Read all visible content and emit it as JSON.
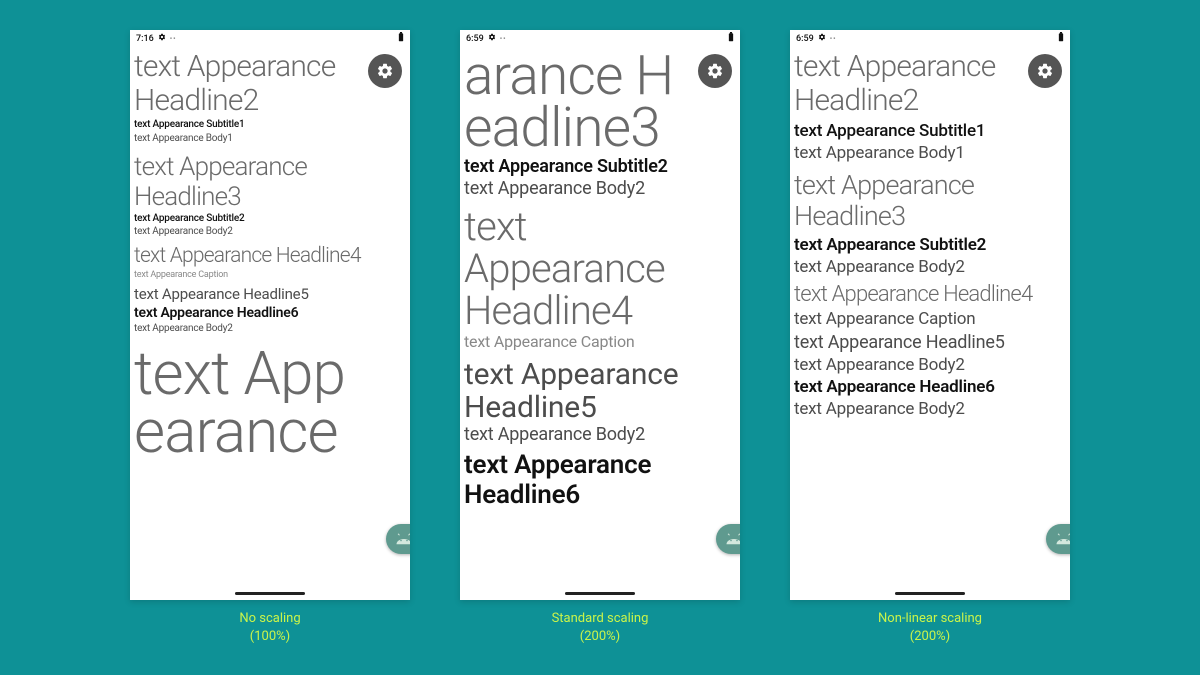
{
  "captions": {
    "a": "No scaling\n(100%)",
    "b": "Standard scaling\n(200%)",
    "c": "Non-linear scaling\n(200%)"
  },
  "icons": {
    "settings": "settings",
    "android": "android",
    "battery": "battery"
  },
  "phoneA": {
    "time": "7:16",
    "lines": [
      {
        "text": "text Appearance Headline2",
        "size": 30,
        "lh": 34,
        "class": "big-light",
        "wrap": true
      },
      {
        "text": "text Appearance Subtitle1",
        "size": 10,
        "lh": 14,
        "class": "bold"
      },
      {
        "text": "text Appearance Body1",
        "size": 10,
        "lh": 14,
        "class": ""
      },
      {
        "text": "text Appearance Headline3",
        "size": 26,
        "lh": 30,
        "class": "big-light",
        "wrap": true,
        "mt": 6
      },
      {
        "text": "text Appearance Subtitle2",
        "size": 10,
        "lh": 13,
        "class": "bold"
      },
      {
        "text": "text Appearance Body2",
        "size": 10,
        "lh": 13,
        "class": ""
      },
      {
        "text": "text Appearance Headline4",
        "size": 21,
        "lh": 25,
        "class": "big-light",
        "wrap": true,
        "mt": 6
      },
      {
        "text": "text Appearance Caption",
        "size": 9,
        "lh": 12,
        "class": "gray-small"
      },
      {
        "text": "text Appearance Headline5",
        "size": 15,
        "lh": 19,
        "class": "",
        "mt": 4
      },
      {
        "text": "text Appearance Headline6",
        "size": 14,
        "lh": 18,
        "class": "semibold"
      },
      {
        "text": "text Appearance Body2",
        "size": 10,
        "lh": 13,
        "class": ""
      },
      {
        "text": "text App",
        "size": 60,
        "lh": 58,
        "class": "big-light",
        "mt": 10
      },
      {
        "text": "earance",
        "size": 60,
        "lh": 58,
        "class": "big-light"
      }
    ]
  },
  "phoneB": {
    "time": "6:59",
    "lines": [
      {
        "text": "arance H",
        "size": 55,
        "lh": 52,
        "class": "big-light"
      },
      {
        "text": "eadline3",
        "size": 55,
        "lh": 52,
        "class": "big-light"
      },
      {
        "text": "text Appearance Subtitle2",
        "size": 18,
        "lh": 22,
        "class": "semibold",
        "mt": 2
      },
      {
        "text": "text Appearance Body2",
        "size": 18,
        "lh": 22,
        "class": ""
      },
      {
        "text": "text Appearance Headline4",
        "size": 40,
        "lh": 42,
        "class": "big-light",
        "wrap": true,
        "mt": 6
      },
      {
        "text": "text Appearance Caption",
        "size": 16,
        "lh": 20,
        "class": "gray-small"
      },
      {
        "text": "text Appearance Headline5",
        "size": 30,
        "lh": 33,
        "class": "",
        "wrap": true,
        "mt": 6
      },
      {
        "text": "text Appearance Body2",
        "size": 18,
        "lh": 22,
        "class": ""
      },
      {
        "text": "text Appearance Headline6",
        "size": 26,
        "lh": 30,
        "class": "semibold",
        "wrap": true,
        "mt": 4
      }
    ]
  },
  "phoneC": {
    "time": "6:59",
    "lines": [
      {
        "text": "text Appearance Headline2",
        "size": 30,
        "lh": 34,
        "class": "big-light",
        "wrap": true
      },
      {
        "text": "text Appearance Subtitle1",
        "size": 17,
        "lh": 22,
        "class": "bold",
        "mt": 2
      },
      {
        "text": "text Appearance Body1",
        "size": 17,
        "lh": 22,
        "class": ""
      },
      {
        "text": "text Appearance Headline3",
        "size": 27,
        "lh": 31,
        "class": "big-light",
        "wrap": true,
        "mt": 6
      },
      {
        "text": "text Appearance Subtitle2",
        "size": 17,
        "lh": 22,
        "class": "semibold",
        "mt": 2
      },
      {
        "text": "text Appearance Body2",
        "size": 17,
        "lh": 22,
        "class": ""
      },
      {
        "text": "text Appearance Headline4",
        "size": 22,
        "lh": 26,
        "class": "big-light",
        "wrap": true,
        "mt": 4
      },
      {
        "text": "text Appearance Caption",
        "size": 17,
        "lh": 22,
        "class": ""
      },
      {
        "text": "text Appearance Headline5",
        "size": 18,
        "lh": 22,
        "class": "",
        "mt": 2
      },
      {
        "text": "text Appearance Body2",
        "size": 17,
        "lh": 22,
        "class": ""
      },
      {
        "text": "text Appearance Headline6",
        "size": 17,
        "lh": 22,
        "class": "semibold"
      },
      {
        "text": "text Appearance Body2",
        "size": 17,
        "lh": 22,
        "class": ""
      }
    ]
  }
}
